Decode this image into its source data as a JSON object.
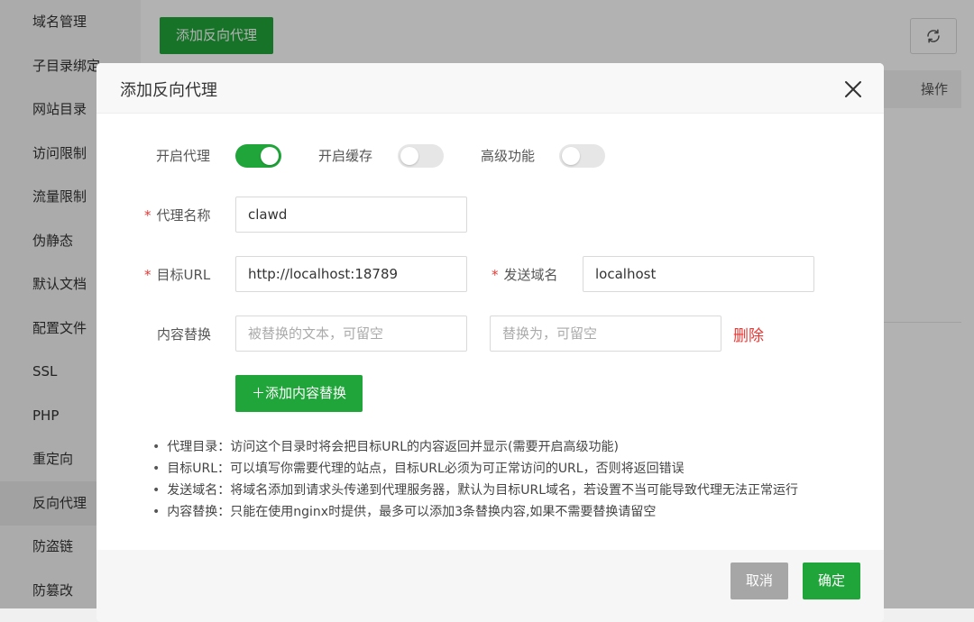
{
  "sidebar": {
    "items": [
      {
        "label": "域名管理"
      },
      {
        "label": "子目录绑定"
      },
      {
        "label": "网站目录"
      },
      {
        "label": "访问限制"
      },
      {
        "label": "流量限制"
      },
      {
        "label": "伪静态"
      },
      {
        "label": "默认文档"
      },
      {
        "label": "配置文件"
      },
      {
        "label": "SSL"
      },
      {
        "label": "PHP"
      },
      {
        "label": "重定向"
      },
      {
        "label": "反向代理"
      },
      {
        "label": "防盗链"
      },
      {
        "label": "防篡改"
      }
    ],
    "active_label": "反向代理"
  },
  "page": {
    "add_button": "添加反向代理",
    "table_header_operation": "操作"
  },
  "modal": {
    "title": "添加反向代理",
    "toggles": {
      "proxy": {
        "label": "开启代理",
        "on": true
      },
      "cache": {
        "label": "开启缓存",
        "on": false
      },
      "advanced": {
        "label": "高级功能",
        "on": false
      }
    },
    "fields": {
      "proxy_name": {
        "label": "代理名称",
        "value": "clawd"
      },
      "target_url": {
        "label": "目标URL",
        "value": "http://localhost:18789"
      },
      "send_domain": {
        "label": "发送域名",
        "value": "localhost"
      },
      "content_replace": {
        "label": "内容替换",
        "from_placeholder": "被替换的文本，可留空",
        "to_placeholder": "替换为，可留空",
        "delete_label": "删除"
      }
    },
    "add_content_button": "＋添加内容替换",
    "tips": [
      "代理目录：访问这个目录时将会把目标URL的内容返回并显示(需要开启高级功能)",
      "目标URL：可以填写你需要代理的站点，目标URL必须为可正常访问的URL，否则将返回错误",
      "发送域名：将域名添加到请求头传递到代理服务器，默认为目标URL域名，若设置不当可能导致代理无法正常运行",
      "内容替换：只能在使用nginx时提供，最多可以添加3条替换内容,如果不需要替换请留空"
    ],
    "cancel_button": "取消",
    "confirm_button": "确定"
  },
  "colors": {
    "accent": "#20a53a",
    "danger": "#e53935",
    "cancel": "#a6a6a6"
  }
}
